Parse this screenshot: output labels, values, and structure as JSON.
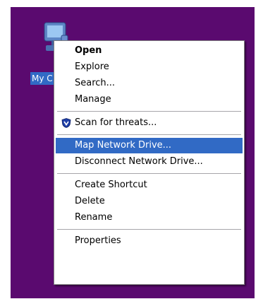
{
  "desktop": {
    "background_color": "#5a0a6f",
    "icon": {
      "name": "my-computer",
      "label": "My C"
    }
  },
  "context_menu": {
    "items": [
      {
        "label": "Open",
        "bold": true
      },
      {
        "label": "Explore"
      },
      {
        "label": "Search..."
      },
      {
        "label": "Manage"
      },
      {
        "label": "Scan for threats...",
        "icon": "shield-icon"
      },
      {
        "label": "Map Network Drive...",
        "highlighted": true
      },
      {
        "label": "Disconnect Network Drive..."
      },
      {
        "label": "Create Shortcut"
      },
      {
        "label": "Delete"
      },
      {
        "label": "Rename"
      },
      {
        "label": "Properties"
      }
    ],
    "highlight_color": "#316ac5"
  }
}
